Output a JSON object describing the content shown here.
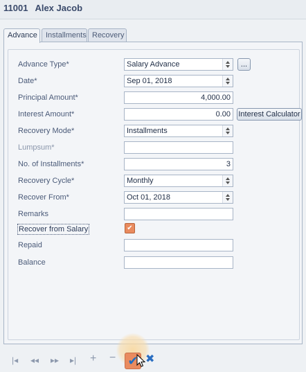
{
  "header": {
    "id": "11001",
    "name": "Alex Jacob"
  },
  "tabs": [
    {
      "label": "Advance",
      "active": true
    },
    {
      "label": "Installments",
      "active": false
    },
    {
      "label": "Recovery",
      "active": false
    }
  ],
  "form": {
    "advance_type": {
      "label": "Advance Type*",
      "value": "Salary Advance",
      "browse": "..."
    },
    "date": {
      "label": "Date*",
      "value": "Sep 01, 2018"
    },
    "principal_amount": {
      "label": "Principal Amount*",
      "value": "4,000.00"
    },
    "interest_amount": {
      "label": "Interest Amount*",
      "value": "0.00",
      "button": "Interest Calculator"
    },
    "recovery_mode": {
      "label": "Recovery Mode*",
      "value": "Installments"
    },
    "lumpsum": {
      "label": "Lumpsum*",
      "value": ""
    },
    "no_of_installments": {
      "label": "No. of Installments*",
      "value": "3"
    },
    "recovery_cycle": {
      "label": "Recovery Cycle*",
      "value": "Monthly"
    },
    "recover_from": {
      "label": "Recover From*",
      "value": "Oct 01, 2018"
    },
    "remarks": {
      "label": "Remarks",
      "value": ""
    },
    "recover_from_salary": {
      "label": "Recover from Salary",
      "checked": true
    },
    "repaid": {
      "label": "Repaid",
      "value": ""
    },
    "balance": {
      "label": "Balance",
      "value": ""
    }
  },
  "nav": {
    "first_icon": "first-record-icon",
    "prev_icon": "previous-record-icon",
    "next_icon": "next-record-icon",
    "last_icon": "last-record-icon",
    "add_icon": "plus-icon",
    "remove_icon": "minus-icon",
    "accept_icon": "checkmark-icon",
    "cancel_icon": "x-icon"
  },
  "colors": {
    "accent": "#e98b5f",
    "check_blue": "#1e6fc2",
    "panel": "#f3f5f8",
    "text": "#3a4a6b"
  }
}
